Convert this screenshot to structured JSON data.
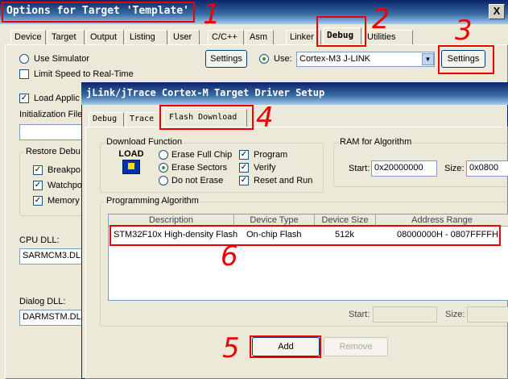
{
  "window": {
    "title": "Options for Target 'Template'",
    "close_label": "X",
    "tabs": [
      "Device",
      "Target",
      "Output",
      "Listing",
      "User",
      "C/C++",
      "Asm",
      "Linker",
      "Debug",
      "Utilities"
    ]
  },
  "debug_tab": {
    "use_simulator_label": "Use Simulator",
    "limit_speed_label": "Limit Speed to Real-Time",
    "settings_label": "Settings",
    "use_label": "Use:",
    "driver_value": "Cortex-M3 J-LINK",
    "settings2_label": "Settings",
    "load_app_label": "Load Applic",
    "init_file_label": "Initialization File:",
    "restore_debug_label": "Restore Debu",
    "breakpoints_label": "Breakpo",
    "watchpoints_label": "Watchpo",
    "memory_label": "Memory",
    "cpu_dll_label": "CPU DLL:",
    "cpu_dll_value": "SARMCM3.DLL",
    "dialog_dll_label": "Dialog DLL:",
    "dialog_dll_value": "DARMSTM.DLL"
  },
  "driver_dialog": {
    "title": "jLink/jTrace Cortex-M Target Driver Setup",
    "tabs": [
      "Debug",
      "Trace",
      "Flash Download"
    ],
    "download_function_label": "Download Function",
    "load_icon_text": "LOAD",
    "erase_full_chip": "Erase Full Chip",
    "erase_sectors": "Erase Sectors",
    "do_not_erase": "Do not Erase",
    "program": "Program",
    "verify": "Verify",
    "reset_and_run": "Reset and Run",
    "ram_label": "RAM for Algorithm",
    "start_label": "Start:",
    "start_value": "0x20000000",
    "size_label": "Size:",
    "size_value": "0x0800",
    "programming_algorithm_label": "Programming Algorithm",
    "columns": [
      "Description",
      "Device Type",
      "Device Size",
      "Address Range"
    ],
    "row": {
      "description": "STM32F10x High-density Flash",
      "device_type": "On-chip Flash",
      "device_size": "512k",
      "address_range": "08000000H - 0807FFFFH"
    },
    "start2_label": "Start:",
    "size2_label": "Size:",
    "add_label": "Add",
    "remove_label": "Remove"
  },
  "annotations": {
    "n1": "1",
    "n2": "2",
    "n3": "3",
    "n4": "4",
    "n5": "5",
    "n6": "6",
    "color": "#e00000"
  }
}
